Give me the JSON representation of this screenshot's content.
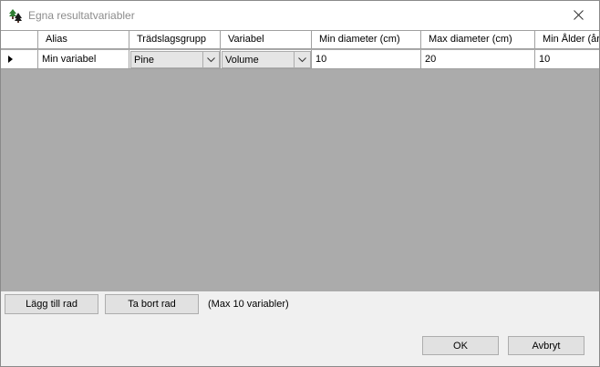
{
  "window": {
    "title": "Egna resultatvariabler"
  },
  "icons": {
    "app": "tree-icon",
    "close": "close-icon",
    "row_marker": "current-row-arrow-icon",
    "combo_arrow": "chevron-down-icon",
    "scroll_left": "chevron-left-icon",
    "scroll_right": "chevron-right-icon"
  },
  "grid": {
    "columns": [
      "Alias",
      "Trädslagsgrupp",
      "Variabel",
      "Min diameter (cm)",
      "Max diameter (cm)",
      "Min Ålder (år)"
    ],
    "rows": [
      {
        "alias": "Min variabel",
        "tradslagsgrupp": "Pine",
        "variabel": "Volume",
        "min_diameter": "10",
        "max_diameter": "20",
        "min_alder": "10"
      }
    ]
  },
  "buttons": {
    "add_row": "Lägg till rad",
    "remove_row": "Ta bort rad",
    "ok": "OK",
    "cancel": "Avbryt"
  },
  "note": "(Max 10 variabler)",
  "colors": {
    "title_text": "#8c8c8c",
    "grid_background": "#ababab",
    "button_face": "#e1e1e1",
    "combo_face": "#e5e5e5",
    "tree_green": "#2e7d32"
  }
}
